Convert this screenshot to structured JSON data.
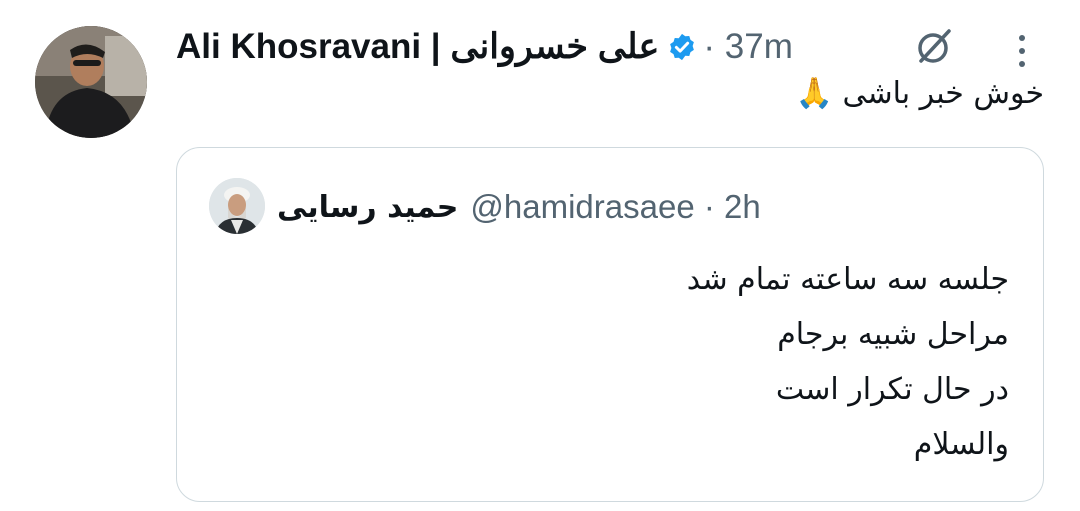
{
  "tweet": {
    "author_name": "Ali Khosravani | علی خسروانی",
    "verified_icon": "verified-badge-icon",
    "meta": "· 37m",
    "text": "خوش خبر باشی 🙏"
  },
  "quoted_tweet": {
    "author_name": "حمید رسایی",
    "handle_time": "@hamidrasaee · 2h",
    "lines": [
      "جلسه سه ساعته تمام شد",
      "مراحل شبیه برجام",
      "در حال تکرار است",
      "والسلام"
    ]
  },
  "colors": {
    "verified": "#1d9bf0",
    "secondary_text": "#536471",
    "border": "#cfd9de"
  }
}
